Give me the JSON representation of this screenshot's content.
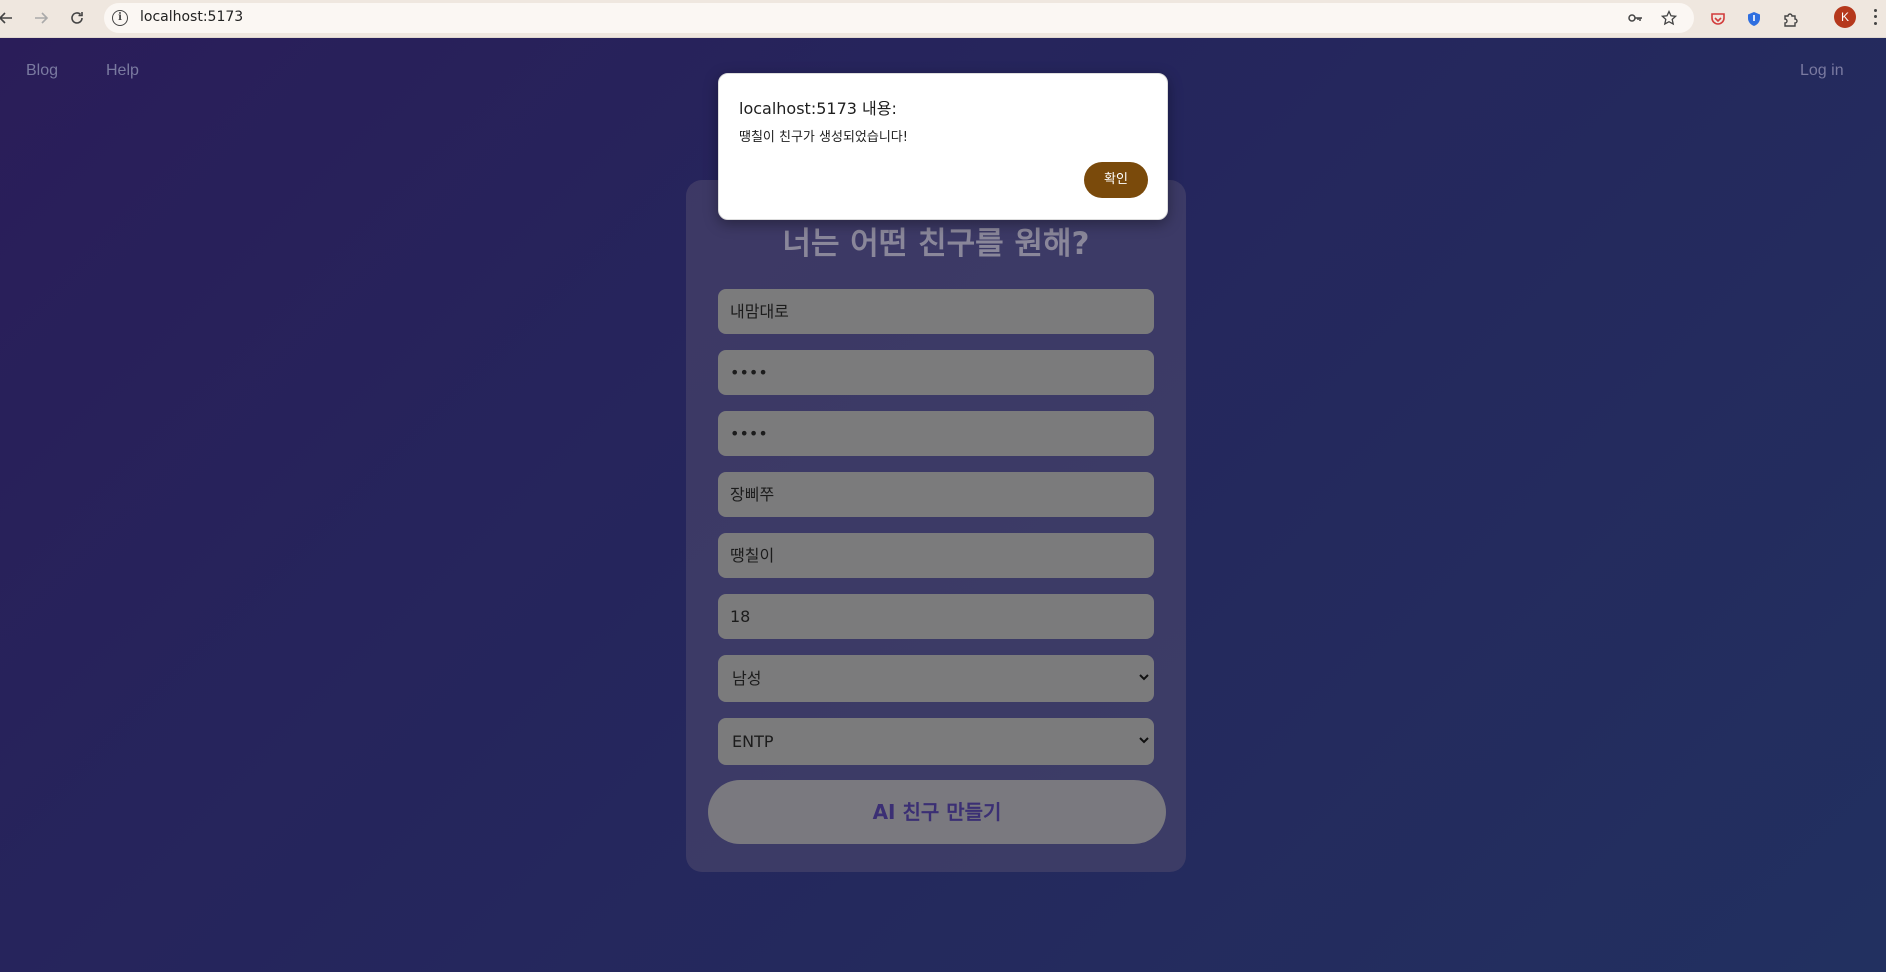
{
  "browser": {
    "url": "localhost:5173",
    "avatar_letter": "K"
  },
  "nav": {
    "blog": "Blog",
    "help": "Help",
    "login": "Log in"
  },
  "form": {
    "heading": "너는 어떤 친구를 원해?",
    "fields": [
      {
        "value": "내맘대로"
      },
      {
        "value": "••••"
      },
      {
        "value": "••••"
      },
      {
        "value": "장삐쭈"
      },
      {
        "value": "땡칠이"
      },
      {
        "value": "18"
      }
    ],
    "gender_select": "남성",
    "mbti_select": "ENTP",
    "submit_label": "AI 친구 만들기"
  },
  "dialog": {
    "title": "localhost:5173 내용:",
    "message": "땡칠이 친구가 생성되었습니다!",
    "ok_label": "확인",
    "accent": "#7a4a0b"
  }
}
